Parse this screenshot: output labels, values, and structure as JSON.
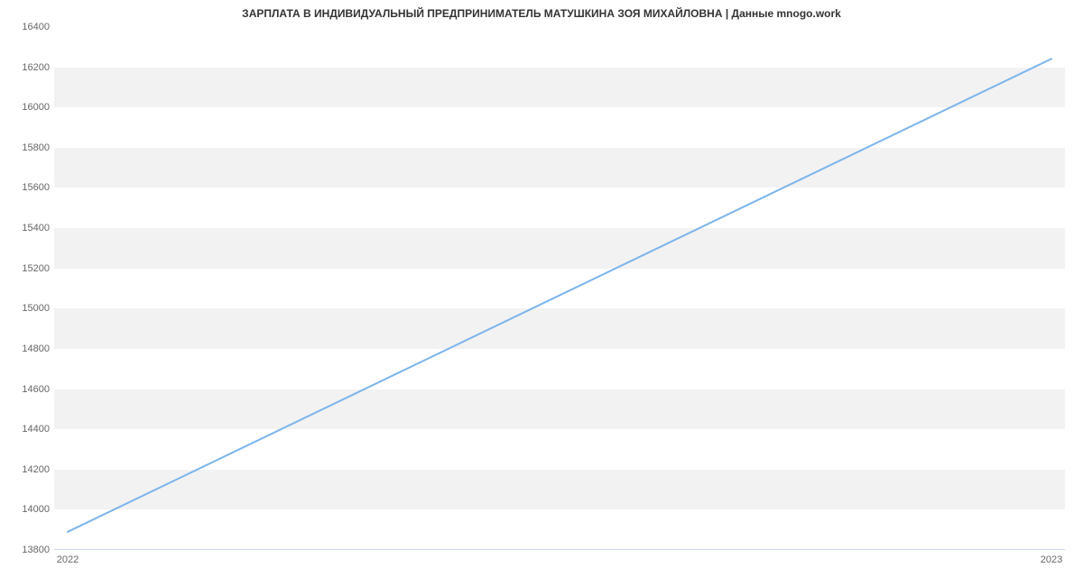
{
  "chart_data": {
    "type": "line",
    "title": "ЗАРПЛАТА В ИНДИВИДУАЛЬНЫЙ ПРЕДПРИНИМАТЕЛЬ МАТУШКИНА ЗОЯ МИХАЙЛОВНА | Данные mnogo.work",
    "x": [
      2022,
      2023
    ],
    "values": [
      13890,
      16242
    ],
    "xlabel": "",
    "ylabel": "",
    "ylim": [
      13800,
      16400
    ],
    "y_ticks": [
      13800,
      14000,
      14200,
      14400,
      14600,
      14800,
      15000,
      15200,
      15400,
      15600,
      15800,
      16000,
      16200,
      16400
    ],
    "x_ticks": [
      2022,
      2023
    ],
    "line_color": "#7cb5ec",
    "band_color": "#f2f2f2"
  }
}
